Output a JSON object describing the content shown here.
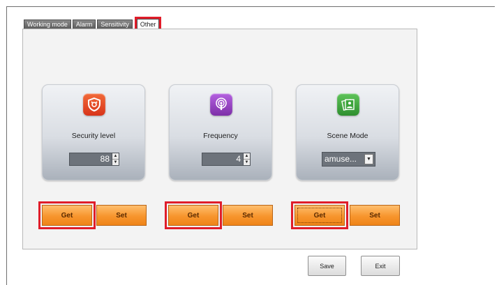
{
  "tabs": [
    {
      "label": "Working mode"
    },
    {
      "label": "Alarm"
    },
    {
      "label": "Sensitivity"
    },
    {
      "label": "Other",
      "active": true
    }
  ],
  "cards": {
    "security": {
      "label": "Security level",
      "value": "88",
      "icon": "shield-icon",
      "color": "#e2451e"
    },
    "frequency": {
      "label": "Frequency",
      "value": "4",
      "icon": "podcast-icon",
      "color": "#8a3fb5"
    },
    "scene": {
      "label": "Scene Mode",
      "value": "amuse...",
      "icon": "photos-icon",
      "color": "#3aa43a"
    }
  },
  "actions": {
    "get_label": "Get",
    "set_label": "Set"
  },
  "footer": {
    "save_label": "Save",
    "exit_label": "Exit"
  },
  "colors": {
    "highlight": "#e01d2a",
    "button_orange": "#f7952d"
  }
}
